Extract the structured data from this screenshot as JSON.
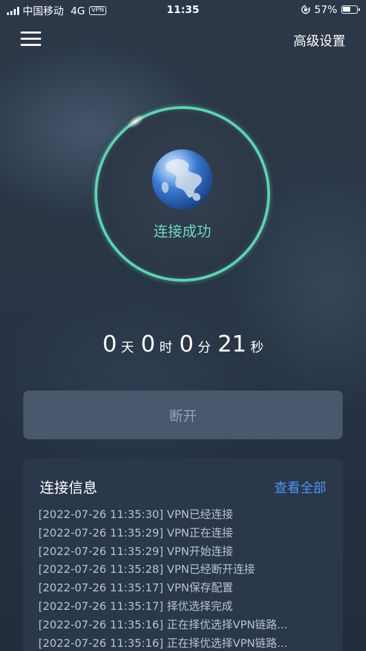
{
  "status_bar": {
    "carrier": "中国移动",
    "network": "4G",
    "vpn_badge": "VPN",
    "time": "11:35",
    "battery_percent_text": "57%",
    "battery_level": 0.57
  },
  "header": {
    "advanced_settings": "高级设置"
  },
  "connection": {
    "status": "连接成功",
    "accent_color": "#5fd2b4"
  },
  "timer": {
    "days": "0",
    "days_unit": "天",
    "hours": "0",
    "hours_unit": "时",
    "minutes": "0",
    "minutes_unit": "分",
    "seconds": "21",
    "seconds_unit": "秒"
  },
  "actions": {
    "disconnect": "断开"
  },
  "info": {
    "title": "连接信息",
    "view_all": "查看全部",
    "logs": [
      "[2022-07-26 11:35:30] VPN已经连接",
      "[2022-07-26 11:35:29] VPN正在连接",
      "[2022-07-26 11:35:29] VPN开始连接",
      "[2022-07-26 11:35:28] VPN已经断开连接",
      "[2022-07-26 11:35:17] VPN保存配置",
      "[2022-07-26 11:35:17] 择优选择完成",
      "[2022-07-26 11:35:16] 正在择优选择VPN链路...",
      "[2022-07-26 11:35:16] 正在择优选择VPN链路..."
    ]
  },
  "icons": {
    "menu": "menu-icon",
    "globe": "globe-icon",
    "lock_rotation": "lock-rotation-icon",
    "battery": "battery-icon",
    "signal": "signal-icon"
  }
}
